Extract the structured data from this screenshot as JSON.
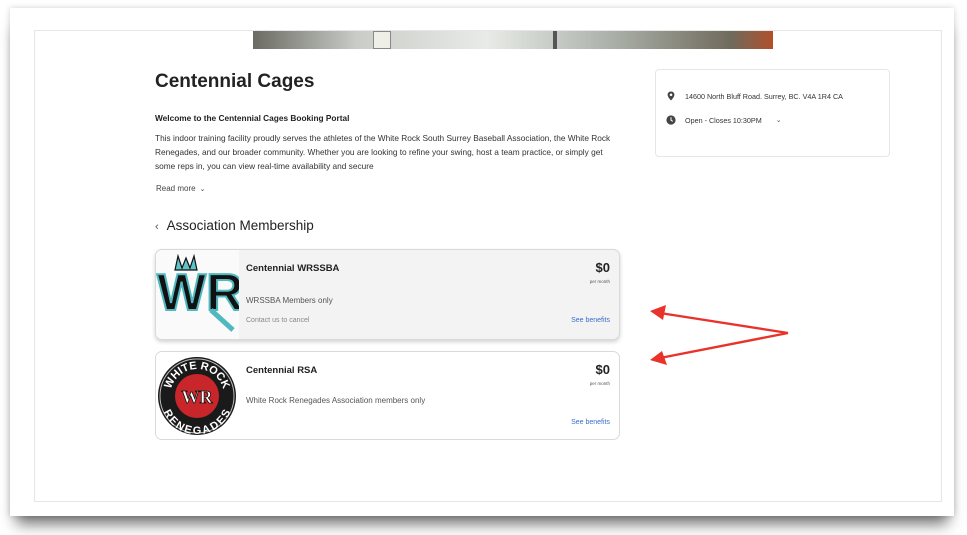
{
  "facility": {
    "title": "Centennial Cages",
    "welcome": "Welcome to the Centennial Cages Booking Portal",
    "description": "This indoor training facility proudly serves the athletes of the White Rock South Surrey Baseball Association, the White Rock Renegades, and our broader community. Whether you are looking to refine your swing, host a team practice, or simply get some reps in, you can view real-time availability and secure",
    "read_more": "Read more"
  },
  "section": {
    "title": "Association Membership"
  },
  "memberships": [
    {
      "name": "Centennial WRSSBA",
      "price": "$0",
      "period": "per month",
      "eligibility": "WRSSBA Members only",
      "cancel_note": "Contact us to cancel",
      "benefits_link": "See benefits",
      "logo_text": "WR"
    },
    {
      "name": "Centennial RSA",
      "price": "$0",
      "period": "per month",
      "eligibility": "White Rock Renegades Association members only",
      "benefits_link": "See benefits",
      "logo_text_top": "WHITE ROCK",
      "logo_text_bottom": "RENEGADES",
      "logo_text_center": "WR"
    }
  ],
  "info": {
    "address": "14600 North Bluff Road. Surrey, BC. V4A 1R4 CA",
    "hours": "Open - Closes 10:30PM"
  },
  "icons": {
    "location": "map-pin-icon",
    "hours": "clock-icon",
    "back": "chevron-left-icon",
    "expand": "chevron-down-icon"
  },
  "colors": {
    "link": "#3b6ec7",
    "annotation_arrow": "#e8322a",
    "wr_logo_teal": "#4fb8c0",
    "rsa_logo_red": "#c8262b"
  }
}
